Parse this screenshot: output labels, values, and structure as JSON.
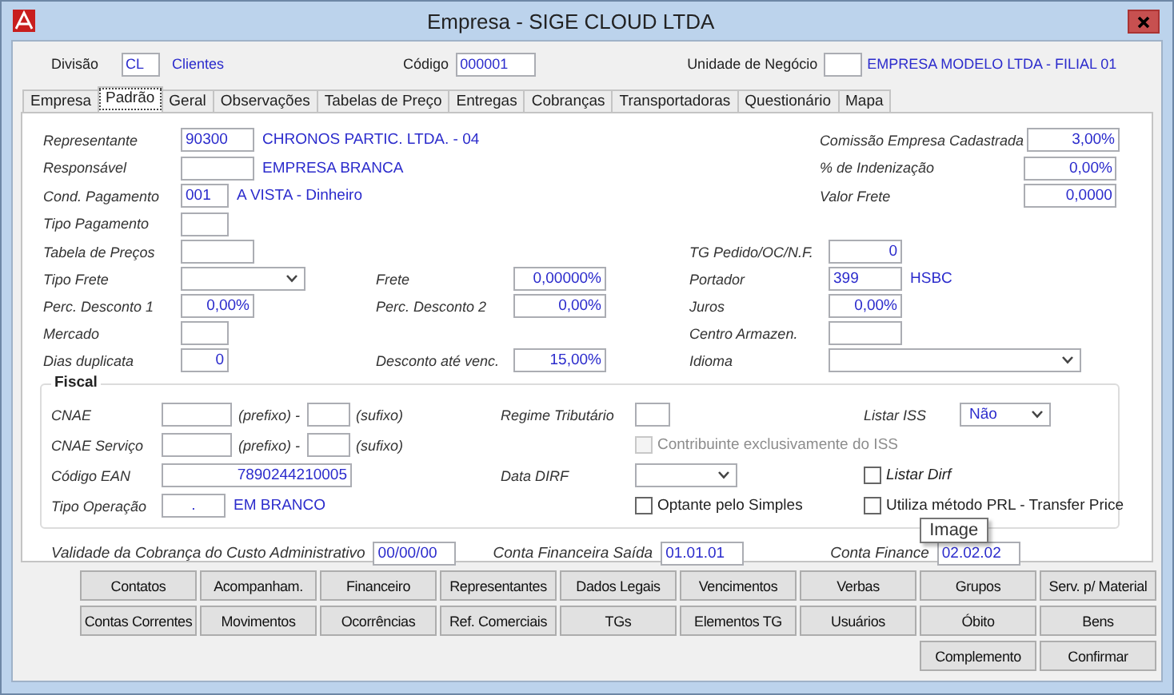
{
  "window": {
    "title": "Empresa - SIGE CLOUD LTDA"
  },
  "header": {
    "division": {
      "label": "Divisão",
      "code": "CL",
      "name": "Clientes"
    },
    "code": {
      "label": "Código",
      "value": "000001"
    },
    "business_unit": {
      "label": "Unidade de Negócio",
      "name": "EMPRESA MODELO LTDA - FILIAL 01"
    }
  },
  "tabs": [
    {
      "label": "Empresa",
      "selected": false
    },
    {
      "label": "Padrão",
      "selected": true
    },
    {
      "label": "Geral",
      "selected": false
    },
    {
      "label": "Observações",
      "selected": false
    },
    {
      "label": "Tabelas de Preço",
      "selected": false
    },
    {
      "label": "Entregas",
      "selected": false
    },
    {
      "label": "Cobranças",
      "selected": false
    },
    {
      "label": "Transportadoras",
      "selected": false
    },
    {
      "label": "Questionário",
      "selected": false
    },
    {
      "label": "Mapa",
      "selected": false
    }
  ],
  "upper_left": [
    {
      "label": "Representante",
      "kind": "text",
      "value": "90300",
      "desc": "CHRONOS PARTIC. LTDA. - 04"
    },
    {
      "label": "Responsável",
      "kind": "text",
      "desc": "EMPRESA BRANCA"
    },
    {
      "label": "Cond. Pagamento",
      "kind": "text",
      "value": "001",
      "desc": "A VISTA - Dinheiro"
    },
    {
      "label": "Tipo Pagamento",
      "kind": "text"
    }
  ],
  "upper_right": [
    {
      "label": "Comissão Empresa Cadastrada",
      "kind": "number",
      "value": "3,00%"
    },
    {
      "label": "% de Indenização",
      "kind": "number",
      "value": "0,00%"
    },
    {
      "label": "Valor Frete",
      "kind": "number",
      "value": "0,0000"
    }
  ],
  "rows": [
    {
      "left": {
        "label": "Tabela de  Preços",
        "kind": "text"
      },
      "right": {
        "label": "TG Pedido/OC/N.F.",
        "kind": "number",
        "value": "0"
      }
    },
    {
      "left": {
        "label": "Tipo Frete",
        "kind": "select"
      },
      "middle": {
        "label": "Frete",
        "kind": "number",
        "value": "0,00000%"
      },
      "right": {
        "label": "Portador",
        "kind": "text",
        "value": "399",
        "desc": "HSBC"
      }
    },
    {
      "left": {
        "label": "Perc. Desconto 1",
        "kind": "number",
        "value": "0,00%"
      },
      "middle": {
        "label": "Perc. Desconto 2",
        "kind": "number",
        "value": "0,00%"
      },
      "right": {
        "label": "Juros",
        "kind": "number",
        "value": "0,00%"
      }
    },
    {
      "left": {
        "label": "Mercado",
        "kind": "text"
      },
      "right": {
        "label": "Centro Armazen.",
        "kind": "text"
      }
    },
    {
      "left": {
        "label": "Dias duplicata",
        "kind": "number",
        "value": "0"
      },
      "middle": {
        "label": "Desconto até venc.",
        "kind": "number",
        "value": "15,00%"
      },
      "right": {
        "label": "Idioma",
        "kind": "select"
      }
    }
  ],
  "fiscal": {
    "title": "Fiscal",
    "rows": [
      {
        "left": {
          "label": "CNAE",
          "kind": "pair",
          "first_hint": "(prefixo) -",
          "second_hint": "(sufixo)"
        },
        "middle": {
          "label": "Regime Tributário",
          "kind": "text"
        },
        "right": {
          "label": "Listar  ISS",
          "kind": "select",
          "value": "Não"
        }
      },
      {
        "left": {
          "label": "CNAE Serviço",
          "kind": "pair",
          "first_hint": "(prefixo) -",
          "second_hint": "(sufixo)"
        },
        "middle": {
          "kind": "checkbox",
          "text": "Contribuinte exclusivamente do ISS",
          "checked": false,
          "disabled": true
        }
      },
      {
        "left": {
          "label": "Código EAN",
          "kind": "number",
          "value": "7890244210005"
        },
        "middle": {
          "label": "Data DIRF",
          "kind": "select"
        },
        "right": {
          "kind": "checkbox",
          "text": "Listar Dirf",
          "checked": false,
          "disabled": false,
          "italic": true
        }
      },
      {
        "left": {
          "label": "Tipo Operação",
          "kind": "text",
          "value": ".",
          "desc": "EM BRANCO"
        },
        "middle": {
          "kind": "checkbox",
          "text": "Optante pelo Simples",
          "checked": false,
          "disabled": false
        },
        "right": {
          "kind": "checkbox",
          "text": "Utiliza método PRL - Transfer Price",
          "checked": false,
          "disabled": false
        }
      }
    ]
  },
  "bottom_fields": [
    {
      "label": "Validade da Cobrança do Custo Administrativo",
      "value": "00/00/00"
    },
    {
      "label": "Conta Financeira Saída",
      "value": "01.01.01"
    },
    {
      "label": "Conta Finance",
      "value": "02.02.02"
    }
  ],
  "tooltip": {
    "text": "Image"
  },
  "button_rows": [
    [
      "Contatos",
      "Acompanham.",
      "Financeiro",
      "Representantes",
      "Dados Legais",
      "Vencimentos",
      "Verbas",
      "Grupos",
      "Serv. p/ Material"
    ],
    [
      "Contas Correntes",
      "Movimentos",
      "Ocorrências",
      "Ref. Comerciais",
      "TGs",
      "Elementos TG",
      "Usuários",
      "Óbito",
      "Bens"
    ],
    [
      "Complemento",
      "Confirmar"
    ]
  ]
}
